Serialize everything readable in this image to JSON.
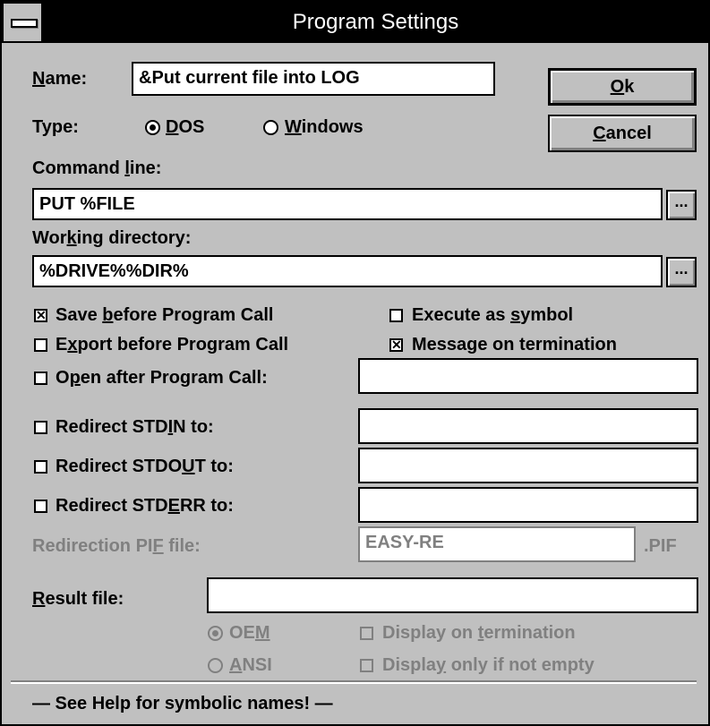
{
  "title": "Program Settings",
  "name_label": "Name:",
  "name_value": "&Put current file into LOG",
  "type_label": "Type:",
  "type_dos": "DOS",
  "type_windows": "Windows",
  "ok_label": "Ok",
  "cancel_label": "Cancel",
  "command_line_label": "Command line:",
  "command_line_value": "PUT %FILE",
  "working_dir_label": "Working directory:",
  "working_dir_value": "%DRIVE%%DIR%",
  "browse_label": "...",
  "checks": {
    "save_before": {
      "label": "Save before Program Call",
      "checked": true
    },
    "export_before": {
      "label": "Export before Program Call",
      "checked": false
    },
    "open_after": {
      "label": "Open after Program Call:",
      "checked": false
    },
    "execute_symbol": {
      "label": "Execute as symbol",
      "checked": false
    },
    "message_termination": {
      "label": "Message on termination",
      "checked": true
    },
    "redirect_stdin": {
      "label": "Redirect STDIN to:",
      "checked": false
    },
    "redirect_stdout": {
      "label": "Redirect STDOUT to:",
      "checked": false
    },
    "redirect_stderr": {
      "label": "Redirect STDERR to:",
      "checked": false
    },
    "display_termination": {
      "label": "Display on termination",
      "checked": false
    },
    "display_not_empty": {
      "label": "Display only if not empty",
      "checked": false
    }
  },
  "open_after_value": "",
  "stdin_value": "",
  "stdout_value": "",
  "stderr_value": "",
  "pif_label": "Redirection PIF file:",
  "pif_value": "EASY-RE",
  "pif_ext": ".PIF",
  "result_label": "Result file:",
  "result_value": "",
  "oem_label": "OEM",
  "ansi_label": "ANSI",
  "help_text": "— See Help for symbolic names! —"
}
